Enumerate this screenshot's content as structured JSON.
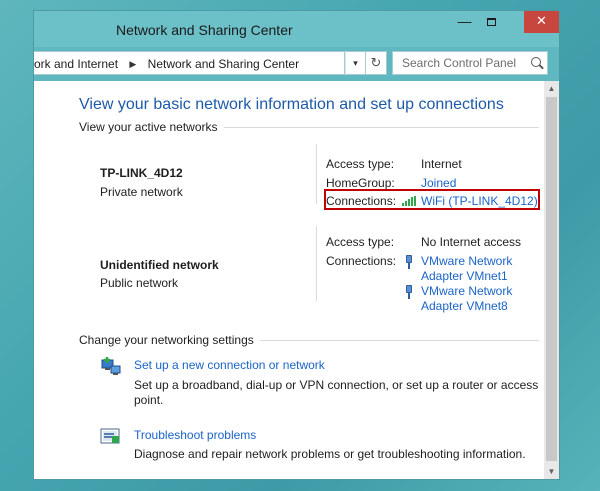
{
  "window": {
    "title": "Network and Sharing Center",
    "minimize": "—",
    "close": "✕"
  },
  "addressbar": {
    "crumbs": [
      "ork and Internet",
      "Network and Sharing Center"
    ],
    "separator": "▶",
    "dropdown": "▾",
    "refresh": "↻",
    "search_placeholder": "Search Control Panel"
  },
  "main": {
    "heading": "View your basic network information and set up connections",
    "active_networks_label": "View your active networks",
    "networks": [
      {
        "name": "TP-LINK_4D12",
        "category": "Private network",
        "access_type_label": "Access type:",
        "access_type": "Internet",
        "homegroup_label": "HomeGroup:",
        "homegroup": "Joined",
        "connections_label": "Connections:",
        "connections": [
          "WiFi (TP-LINK_4D12)"
        ]
      },
      {
        "name": "Unidentified network",
        "category": "Public network",
        "access_type_label": "Access type:",
        "access_type": "No Internet access",
        "connections_label": "Connections:",
        "connections": [
          {
            "line1": "VMware Network",
            "line2": "Adapter VMnet1"
          },
          {
            "line1": "VMware Network",
            "line2": "Adapter VMnet8"
          }
        ]
      }
    ],
    "change_settings_label": "Change your networking settings",
    "tasks": [
      {
        "link": "Set up a new connection or network",
        "description": "Set up a broadband, dial-up or VPN connection, or set up a router or access point."
      },
      {
        "link": "Troubleshoot problems",
        "description": "Diagnose and repair network problems or get troubleshooting information."
      }
    ]
  },
  "colors": {
    "link": "#1a64c8",
    "heading": "#1e5aa8",
    "highlight": "#c00000",
    "close": "#c7463d",
    "titlebar": "#6cc0c8"
  }
}
